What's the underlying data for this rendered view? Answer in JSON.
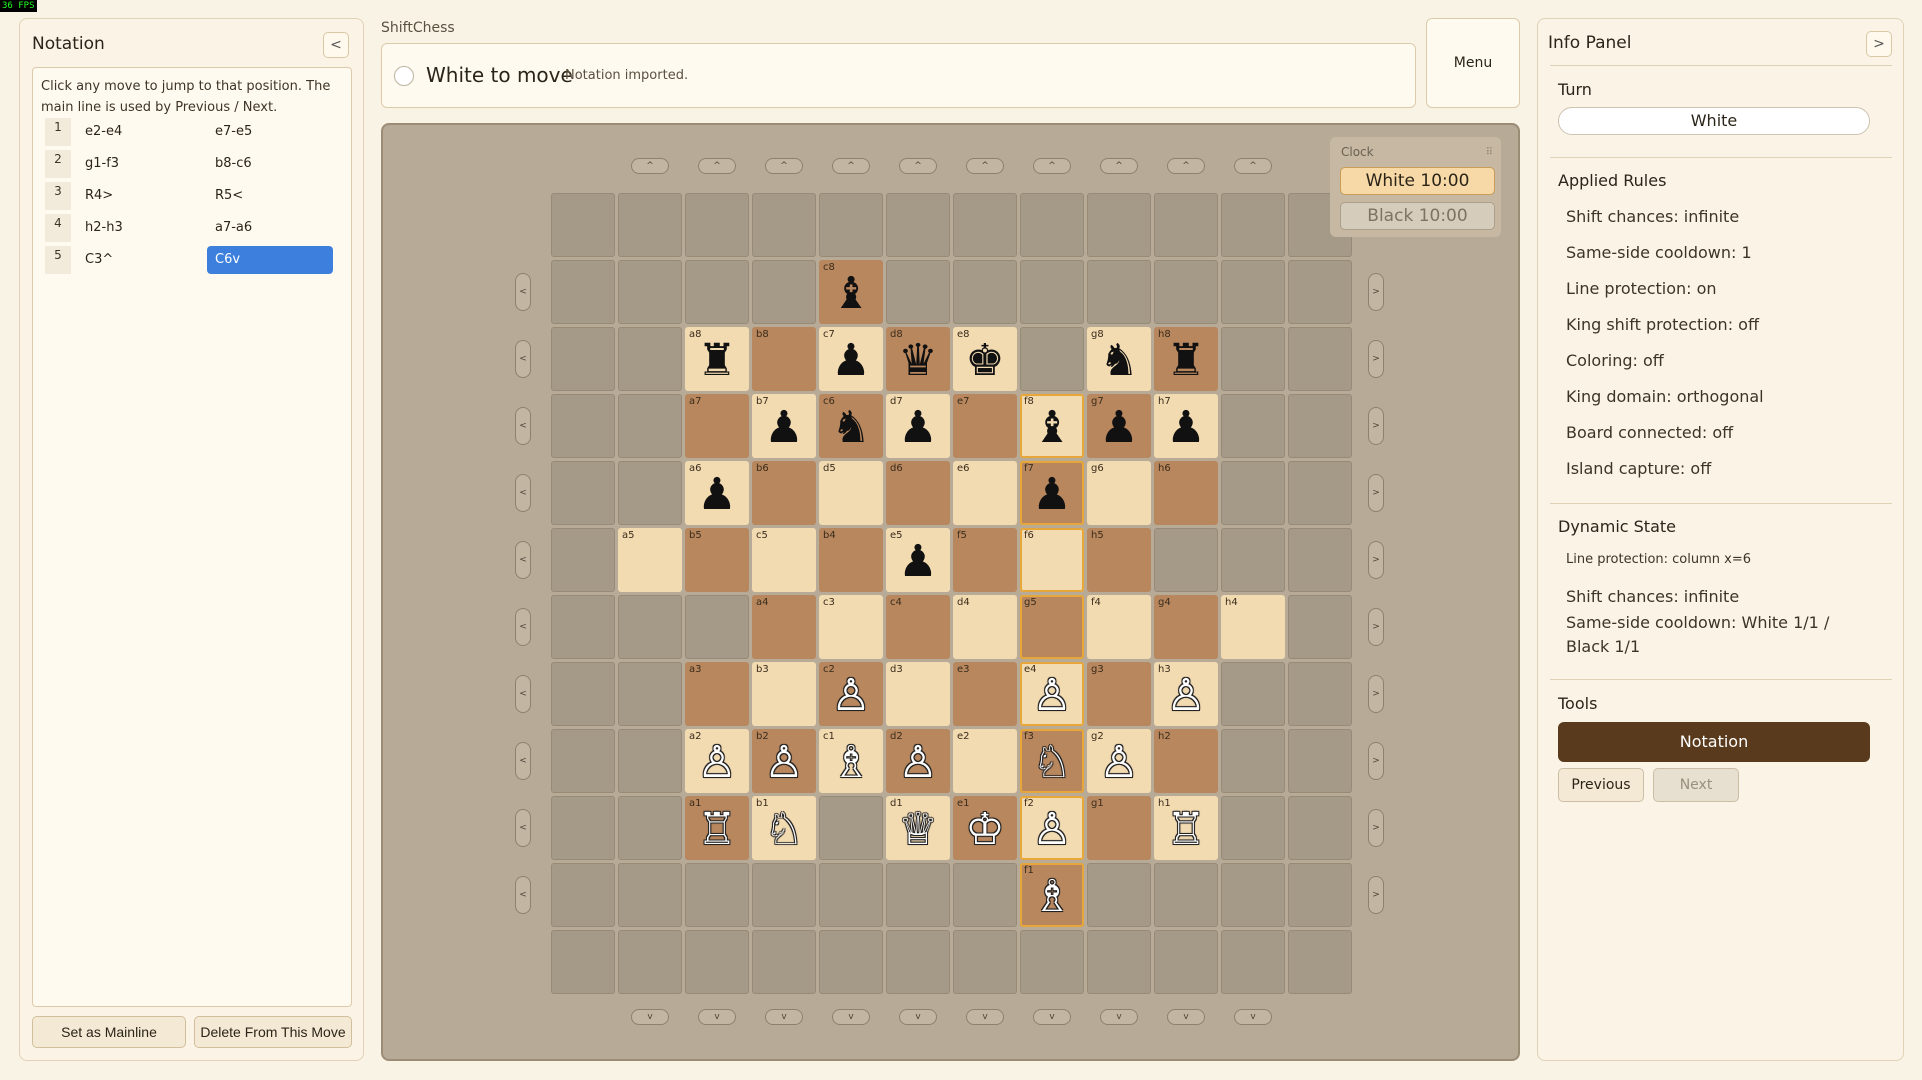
{
  "fps": "36 FPS",
  "app_title": "ShiftChess",
  "status": {
    "main": "White to move",
    "sub": "Notation imported."
  },
  "menu_label": "Menu",
  "notation": {
    "title": "Notation",
    "collapse": "<",
    "help": "Click any move to jump to that position. The main line is used by Previous / Next.",
    "moves": [
      {
        "num": "1",
        "white": "e2-e4",
        "black": "e7-e5"
      },
      {
        "num": "2",
        "white": "g1-f3",
        "black": "b8-c6"
      },
      {
        "num": "3",
        "white": "R4>",
        "black": "R5<"
      },
      {
        "num": "4",
        "white": "h2-h3",
        "black": "a7-a6"
      },
      {
        "num": "5",
        "white": "C3^",
        "black": "C6v"
      }
    ],
    "selected_move": "C6v",
    "set_mainline": "Set as Mainline",
    "delete_from": "Delete From This Move"
  },
  "clock": {
    "title": "Clock",
    "handle": "⠿",
    "white": "White 10:00",
    "black": "Black 10:00"
  },
  "board": {
    "up_arrow": "^",
    "down_arrow": "v",
    "left_arrow": "<",
    "right_arrow": ">",
    "rows": [
      [
        {
          "t": "e"
        },
        {
          "t": "e"
        },
        {
          "t": "e"
        },
        {
          "t": "e"
        },
        {
          "t": "e"
        },
        {
          "t": "e"
        },
        {
          "t": "e"
        },
        {
          "t": "e"
        },
        {
          "t": "e"
        },
        {
          "t": "e"
        },
        {
          "t": "e"
        },
        {
          "t": "e"
        }
      ],
      [
        {
          "t": "e"
        },
        {
          "t": "e"
        },
        {
          "t": "e"
        },
        {
          "t": "e"
        },
        {
          "t": "d",
          "c": "c8",
          "p": "♝",
          "pc": "b"
        },
        {
          "t": "e"
        },
        {
          "t": "e"
        },
        {
          "t": "e"
        },
        {
          "t": "e"
        },
        {
          "t": "e"
        },
        {
          "t": "e"
        },
        {
          "t": "e"
        }
      ],
      [
        {
          "t": "e"
        },
        {
          "t": "e"
        },
        {
          "t": "l",
          "c": "a8",
          "p": "♜",
          "pc": "b"
        },
        {
          "t": "d",
          "c": "b8"
        },
        {
          "t": "l",
          "c": "c7",
          "p": "♟",
          "pc": "b"
        },
        {
          "t": "d",
          "c": "d8",
          "p": "♛",
          "pc": "b"
        },
        {
          "t": "l",
          "c": "e8",
          "p": "♚",
          "pc": "b"
        },
        {
          "t": "e"
        },
        {
          "t": "l",
          "c": "g8",
          "p": "♞",
          "pc": "b"
        },
        {
          "t": "d",
          "c": "h8",
          "p": "♜",
          "pc": "b"
        },
        {
          "t": "e"
        },
        {
          "t": "e"
        }
      ],
      [
        {
          "t": "e"
        },
        {
          "t": "e"
        },
        {
          "t": "d",
          "c": "a7"
        },
        {
          "t": "l",
          "c": "b7",
          "p": "♟",
          "pc": "b"
        },
        {
          "t": "d",
          "c": "c6",
          "p": "♞",
          "pc": "b"
        },
        {
          "t": "l",
          "c": "d7",
          "p": "♟",
          "pc": "b"
        },
        {
          "t": "d",
          "c": "e7"
        },
        {
          "t": "l",
          "c": "f8",
          "p": "♝",
          "pc": "b",
          "h": true
        },
        {
          "t": "d",
          "c": "g7",
          "p": "♟",
          "pc": "b"
        },
        {
          "t": "l",
          "c": "h7",
          "p": "♟",
          "pc": "b"
        },
        {
          "t": "e"
        },
        {
          "t": "e"
        }
      ],
      [
        {
          "t": "e"
        },
        {
          "t": "e"
        },
        {
          "t": "l",
          "c": "a6",
          "p": "♟",
          "pc": "b"
        },
        {
          "t": "d",
          "c": "b6"
        },
        {
          "t": "l",
          "c": "d5"
        },
        {
          "t": "d",
          "c": "d6"
        },
        {
          "t": "l",
          "c": "e6"
        },
        {
          "t": "d",
          "c": "f7",
          "p": "♟",
          "pc": "b",
          "h": true
        },
        {
          "t": "l",
          "c": "g6"
        },
        {
          "t": "d",
          "c": "h6"
        },
        {
          "t": "e"
        },
        {
          "t": "e"
        }
      ],
      [
        {
          "t": "e"
        },
        {
          "t": "l",
          "c": "a5"
        },
        {
          "t": "d",
          "c": "b5"
        },
        {
          "t": "l",
          "c": "c5"
        },
        {
          "t": "d",
          "c": "b4"
        },
        {
          "t": "l",
          "c": "e5",
          "p": "♟",
          "pc": "b"
        },
        {
          "t": "d",
          "c": "f5"
        },
        {
          "t": "l",
          "c": "f6",
          "h": true
        },
        {
          "t": "d",
          "c": "h5"
        },
        {
          "t": "e"
        },
        {
          "t": "e"
        },
        {
          "t": "e"
        }
      ],
      [
        {
          "t": "e"
        },
        {
          "t": "e"
        },
        {
          "t": "e"
        },
        {
          "t": "d",
          "c": "a4"
        },
        {
          "t": "l",
          "c": "c3"
        },
        {
          "t": "d",
          "c": "c4"
        },
        {
          "t": "l",
          "c": "d4"
        },
        {
          "t": "d",
          "c": "g5",
          "h": true
        },
        {
          "t": "l",
          "c": "f4"
        },
        {
          "t": "d",
          "c": "g4"
        },
        {
          "t": "l",
          "c": "h4"
        },
        {
          "t": "e"
        }
      ],
      [
        {
          "t": "e"
        },
        {
          "t": "e"
        },
        {
          "t": "d",
          "c": "a3"
        },
        {
          "t": "l",
          "c": "b3"
        },
        {
          "t": "d",
          "c": "c2",
          "p": "♙",
          "pc": "w"
        },
        {
          "t": "l",
          "c": "d3"
        },
        {
          "t": "d",
          "c": "e3"
        },
        {
          "t": "l",
          "c": "e4",
          "p": "♙",
          "pc": "w",
          "h": true
        },
        {
          "t": "d",
          "c": "g3"
        },
        {
          "t": "l",
          "c": "h3",
          "p": "♙",
          "pc": "w"
        },
        {
          "t": "e"
        },
        {
          "t": "e"
        }
      ],
      [
        {
          "t": "e"
        },
        {
          "t": "e"
        },
        {
          "t": "l",
          "c": "a2",
          "p": "♙",
          "pc": "w"
        },
        {
          "t": "d",
          "c": "b2",
          "p": "♙",
          "pc": "w"
        },
        {
          "t": "l",
          "c": "c1",
          "p": "♗",
          "pc": "w"
        },
        {
          "t": "d",
          "c": "d2",
          "p": "♙",
          "pc": "w"
        },
        {
          "t": "l",
          "c": "e2"
        },
        {
          "t": "d",
          "c": "f3",
          "p": "♘",
          "pc": "w",
          "h": true
        },
        {
          "t": "l",
          "c": "g2",
          "p": "♙",
          "pc": "w"
        },
        {
          "t": "d",
          "c": "h2"
        },
        {
          "t": "e"
        },
        {
          "t": "e"
        }
      ],
      [
        {
          "t": "e"
        },
        {
          "t": "e"
        },
        {
          "t": "d",
          "c": "a1",
          "p": "♖",
          "pc": "w"
        },
        {
          "t": "l",
          "c": "b1",
          "p": "♘",
          "pc": "w"
        },
        {
          "t": "e"
        },
        {
          "t": "l",
          "c": "d1",
          "p": "♕",
          "pc": "w"
        },
        {
          "t": "d",
          "c": "e1",
          "p": "♔",
          "pc": "w"
        },
        {
          "t": "l",
          "c": "f2",
          "p": "♙",
          "pc": "w",
          "h": true
        },
        {
          "t": "d",
          "c": "g1"
        },
        {
          "t": "l",
          "c": "h1",
          "p": "♖",
          "pc": "w"
        },
        {
          "t": "e"
        },
        {
          "t": "e"
        }
      ],
      [
        {
          "t": "e"
        },
        {
          "t": "e"
        },
        {
          "t": "e"
        },
        {
          "t": "e"
        },
        {
          "t": "e"
        },
        {
          "t": "e"
        },
        {
          "t": "e"
        },
        {
          "t": "d",
          "c": "f1",
          "p": "♗",
          "pc": "w",
          "h": true
        },
        {
          "t": "e"
        },
        {
          "t": "e"
        },
        {
          "t": "e"
        },
        {
          "t": "e"
        }
      ],
      [
        {
          "t": "e"
        },
        {
          "t": "e"
        },
        {
          "t": "e"
        },
        {
          "t": "e"
        },
        {
          "t": "e"
        },
        {
          "t": "e"
        },
        {
          "t": "e"
        },
        {
          "t": "e"
        },
        {
          "t": "e"
        },
        {
          "t": "e"
        },
        {
          "t": "e"
        },
        {
          "t": "e"
        }
      ]
    ]
  },
  "info": {
    "title": "Info Panel",
    "collapse": ">",
    "turn_label": "Turn",
    "turn_value": "White",
    "rules_label": "Applied Rules",
    "rules": [
      "Shift chances: infinite",
      "Same-side cooldown: 1",
      "Line protection: on",
      "King shift protection: off",
      "Coloring: off",
      "King domain: orthogonal",
      "Board connected: off",
      "Island capture: off"
    ],
    "dynamic_label": "Dynamic State",
    "line_protection": "Line protection: column x=6",
    "shift_chances": "Shift chances: infinite",
    "cooldown": "Same-side cooldown: White 1/1 / Black 1/1",
    "tools_label": "Tools",
    "notation_btn": "Notation",
    "previous": "Previous",
    "next": "Next"
  }
}
